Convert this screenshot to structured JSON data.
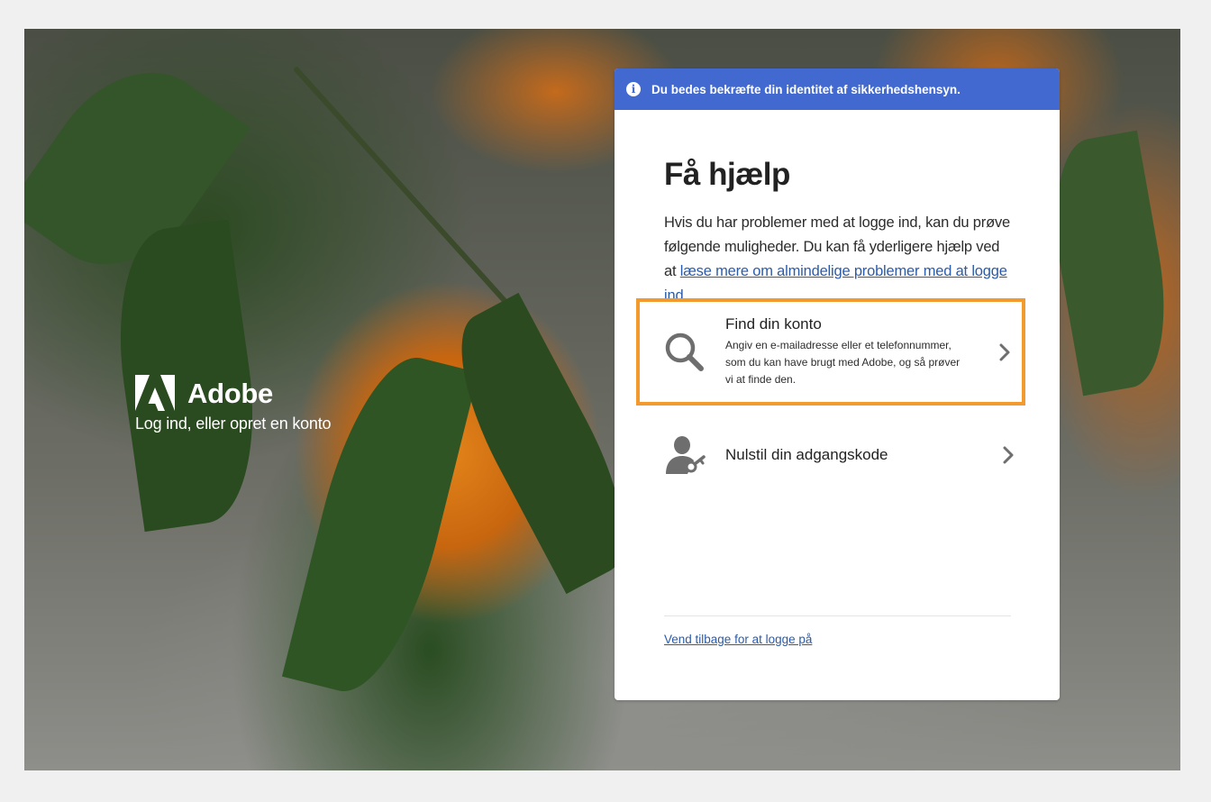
{
  "brand": {
    "name": "Adobe",
    "tagline": "Log ind, eller opret en konto",
    "logo_icon": "adobe-logo-icon"
  },
  "banner": {
    "icon": "info-icon",
    "glyph": "i",
    "text": "Du bedes bekræfte din identitet af sikkerhedshensyn.",
    "color": "#4269d0"
  },
  "page": {
    "title": "Få hjælp",
    "intro": "Hvis du har problemer med at logge ind, kan du prøve følgende muligheder. Du kan få yderligere hjælp ved at ",
    "intro_link": "læse mere om almindelige problemer med at logge ind",
    "intro_end": "."
  },
  "options": [
    {
      "icon": "search-icon",
      "title": "Find din konto",
      "description": "Angiv en e-mailadresse eller et telefonnummer, som du kan have brugt med Adobe, og så prøver vi at finde den.",
      "highlight_color": "#f29a2e"
    },
    {
      "icon": "user-key-icon",
      "title": "Nulstil din adgangskode"
    }
  ],
  "footer": {
    "back_link": "Vend tilbage for at logge på"
  }
}
